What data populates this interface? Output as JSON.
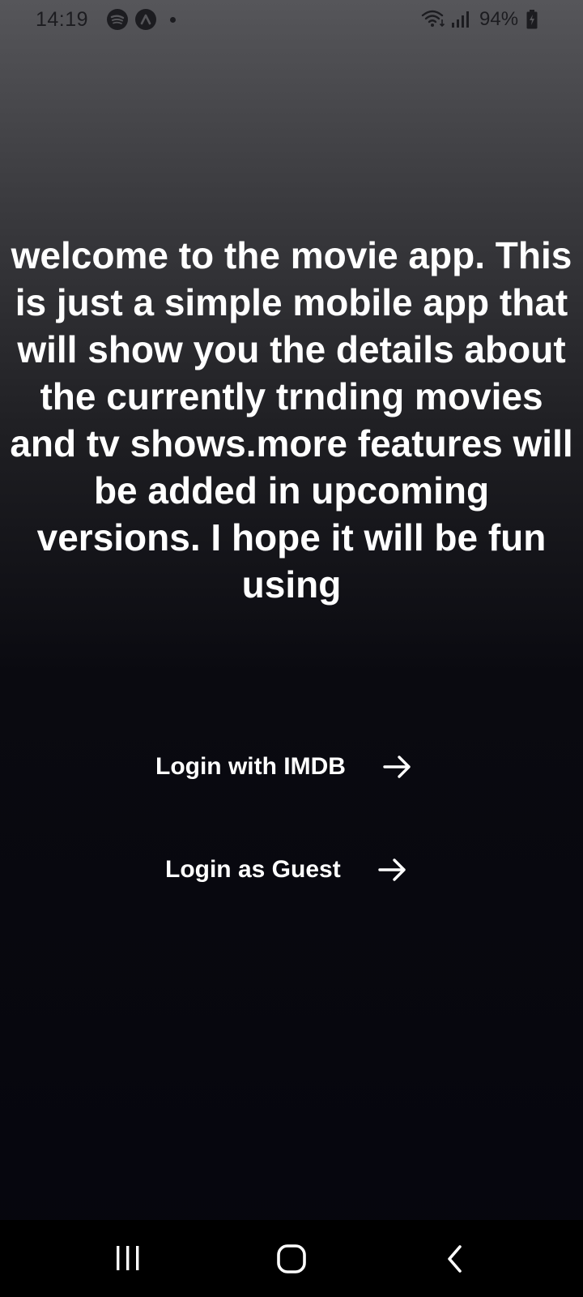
{
  "status_bar": {
    "time": "14:19",
    "battery": "94%",
    "icons": [
      "spotify-icon",
      "app-icon",
      "notification-dot",
      "wifi-icon",
      "signal-icon",
      "battery-charging-icon"
    ]
  },
  "welcome": {
    "text": "welcome to the movie app. This is just a simple mobile app that will show you the details about the currently trnding movies and tv shows.more features will be added in upcoming versions. I hope it will be fun using"
  },
  "buttons": {
    "login_imdb": "Login with IMDB",
    "login_guest": "Login as Guest"
  },
  "nav": {
    "icons": [
      "recents-icon",
      "home-icon",
      "back-icon"
    ]
  },
  "colors": {
    "text": "#ffffff",
    "background_top": "#56565a",
    "background_bottom": "#05050d",
    "nav_bar": "#000000"
  }
}
